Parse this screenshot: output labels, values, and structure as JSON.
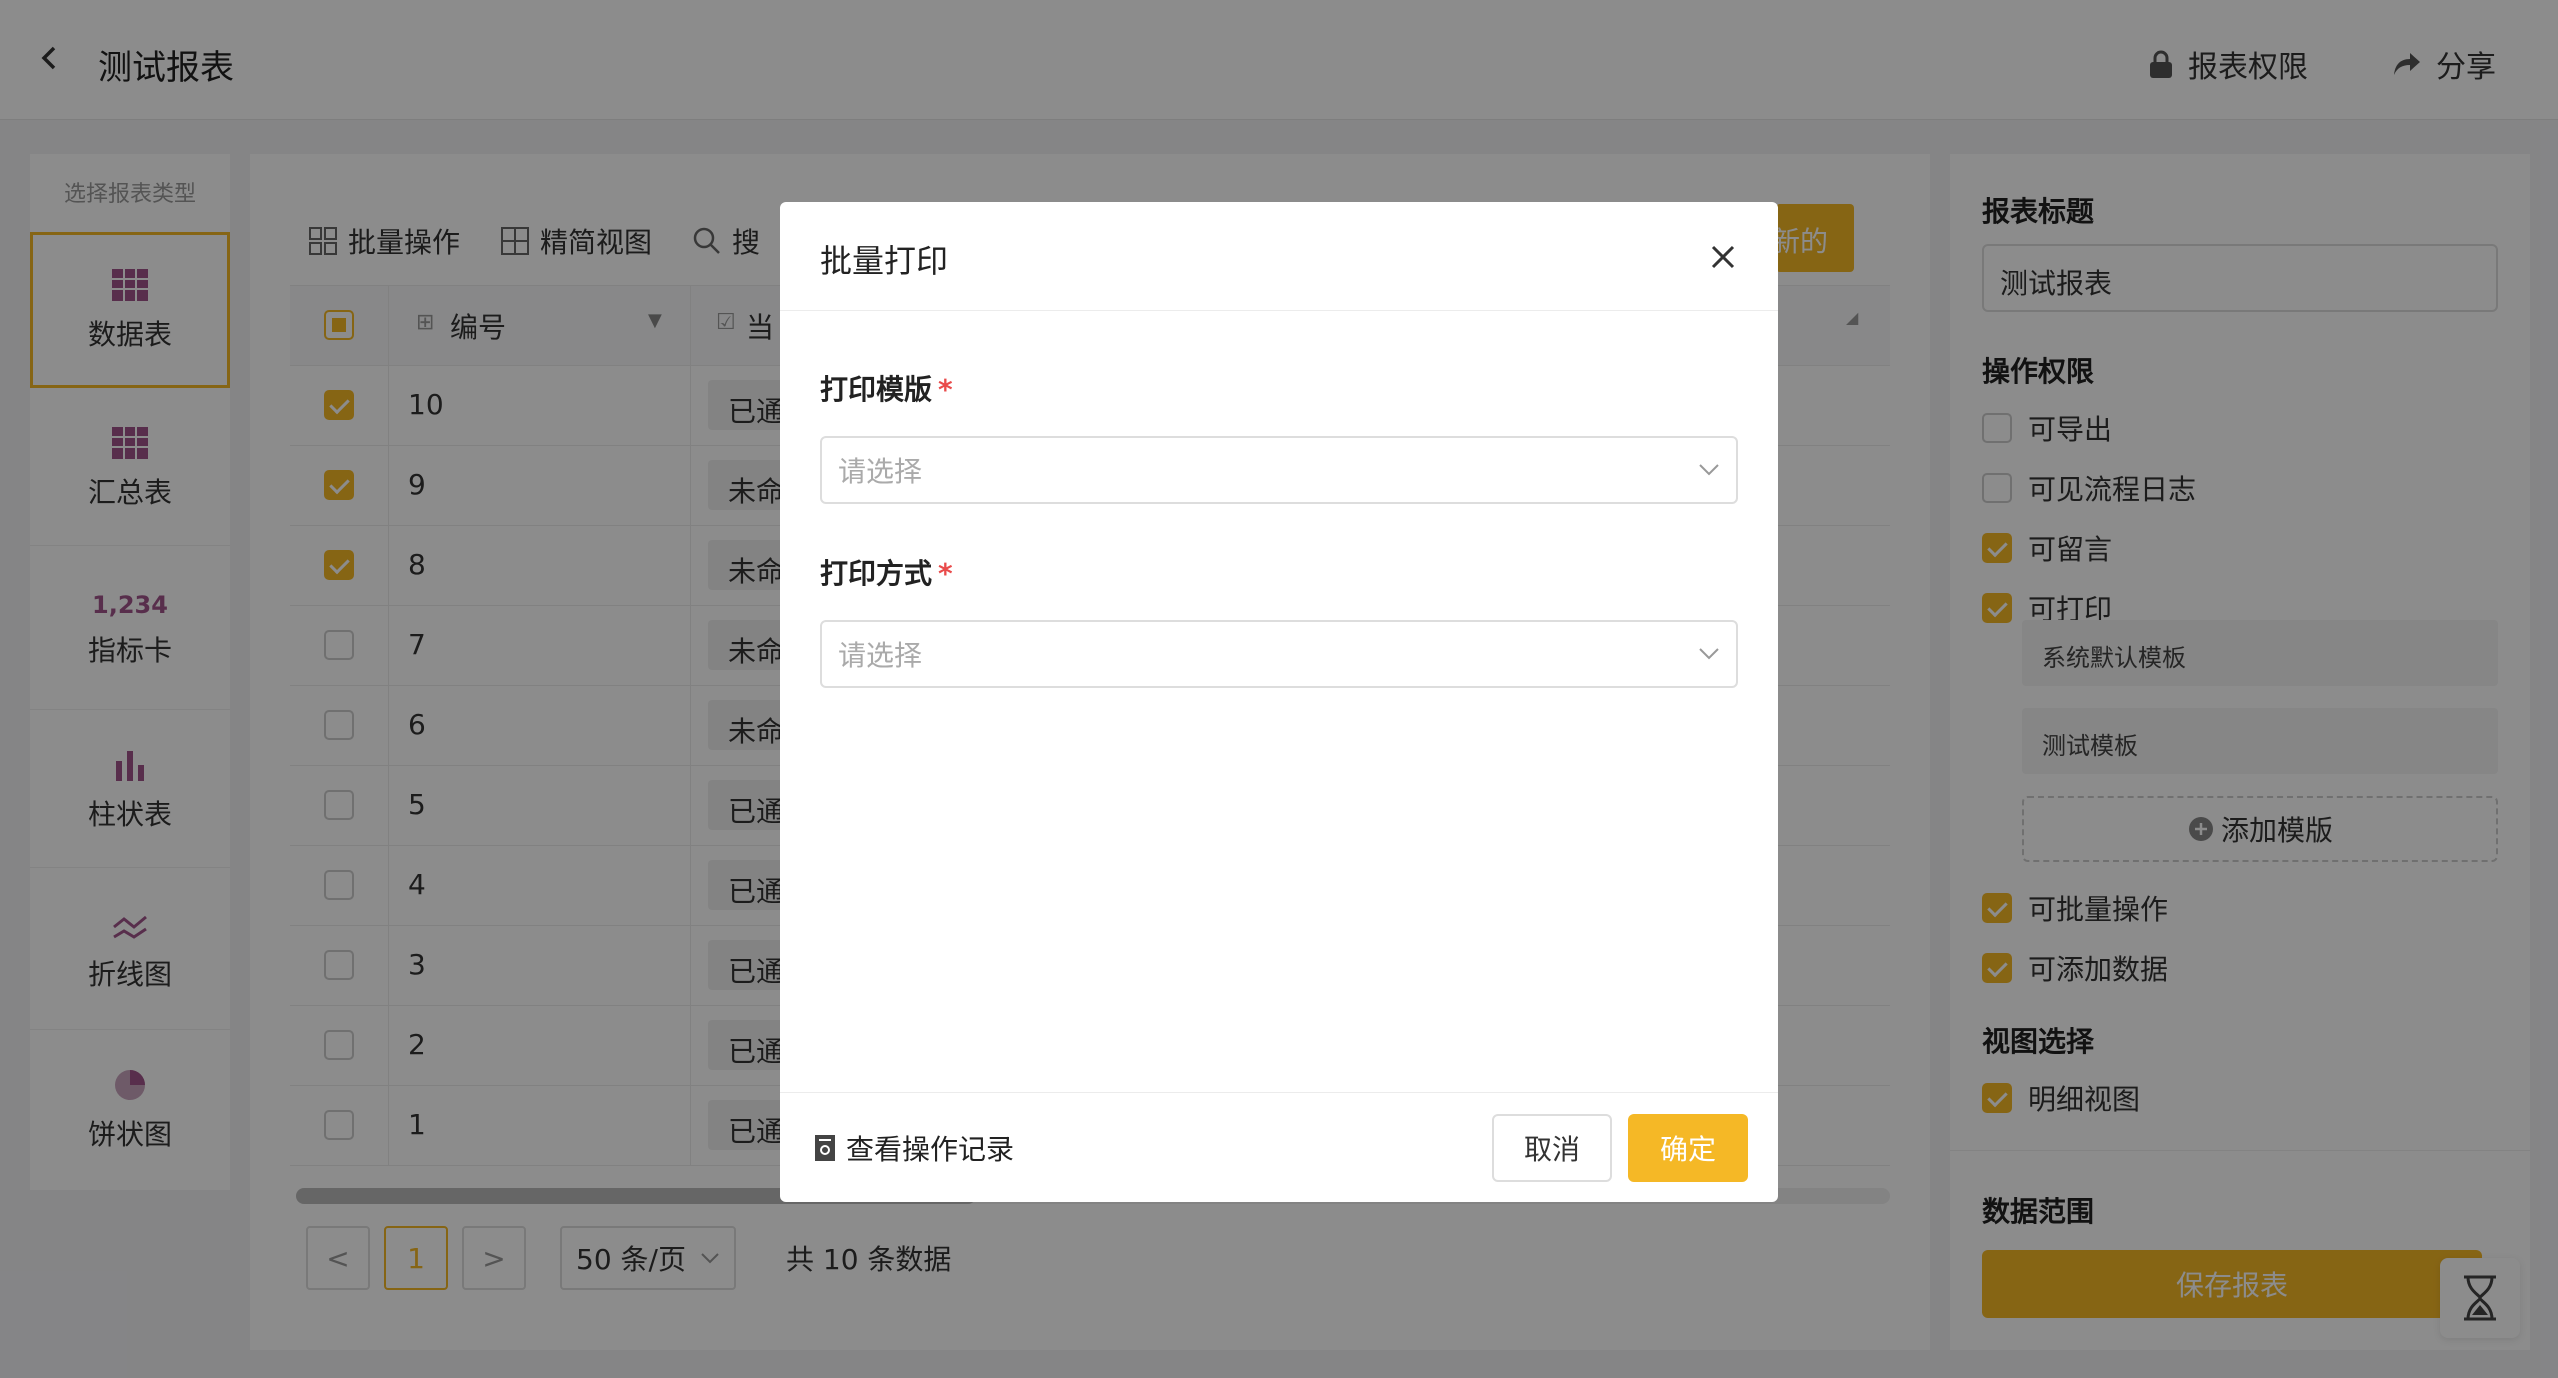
{
  "header": {
    "title": "测试报表",
    "permission_label": "报表权限",
    "share_label": "分享"
  },
  "left_panel": {
    "caption": "选择报表类型",
    "types": [
      {
        "label": "数据表",
        "icon": "data-table-icon"
      },
      {
        "label": "汇总表",
        "icon": "summary-table-icon"
      },
      {
        "label": "指标卡",
        "icon": "metric-card-icon",
        "icon_text": "1,234"
      },
      {
        "label": "柱状表",
        "icon": "bar-chart-icon"
      },
      {
        "label": "折线图",
        "icon": "line-chart-icon"
      },
      {
        "label": "饼状图",
        "icon": "pie-chart-icon"
      }
    ]
  },
  "toolbar": {
    "batch": "批量操作",
    "simple_view": "精简视图",
    "search": "搜",
    "new_button": "新的"
  },
  "table": {
    "col_id": "编号",
    "col_status": "当",
    "rows": [
      {
        "id": "10",
        "status": "已通",
        "checked": true
      },
      {
        "id": "9",
        "status": "未命",
        "checked": true
      },
      {
        "id": "8",
        "status": "未命",
        "checked": true
      },
      {
        "id": "7",
        "status": "未命",
        "checked": false
      },
      {
        "id": "6",
        "status": "未命",
        "checked": false
      },
      {
        "id": "5",
        "status": "已通",
        "checked": false
      },
      {
        "id": "4",
        "status": "已通",
        "checked": false
      },
      {
        "id": "3",
        "status": "已通",
        "checked": false
      },
      {
        "id": "2",
        "status": "已通",
        "checked": false
      },
      {
        "id": "1",
        "status": "已通",
        "checked": false
      }
    ]
  },
  "pager": {
    "prev": "<",
    "current": "1",
    "next": ">",
    "page_size": "50 条/页",
    "total": "共 10 条数据"
  },
  "right_panel": {
    "title_label": "报表标题",
    "title_value": "测试报表",
    "perm_label": "操作权限",
    "perms": [
      {
        "label": "可导出",
        "checked": false
      },
      {
        "label": "可见流程日志",
        "checked": false
      },
      {
        "label": "可留言",
        "checked": true
      },
      {
        "label": "可打印",
        "checked": true
      }
    ],
    "templates": [
      "系统默认模板",
      "测试模板"
    ],
    "add_template": "添加模版",
    "perms2": [
      {
        "label": "可批量操作",
        "checked": true
      },
      {
        "label": "可添加数据",
        "checked": true
      }
    ],
    "view_label": "视图选择",
    "view_option": "明细视图",
    "range_label": "数据范围",
    "save": "保存报表"
  },
  "modal": {
    "title": "批量打印",
    "template_label": "打印模版",
    "template_placeholder": "请选择",
    "mode_label": "打印方式",
    "mode_placeholder": "请选择",
    "required_mark": "*",
    "log_link": "查看操作记录",
    "cancel": "取消",
    "ok": "确定"
  },
  "colors": {
    "accent": "#f5b826",
    "overlay": "rgba(0,0,0,0.45)",
    "icon_purple": "#a0558a"
  }
}
